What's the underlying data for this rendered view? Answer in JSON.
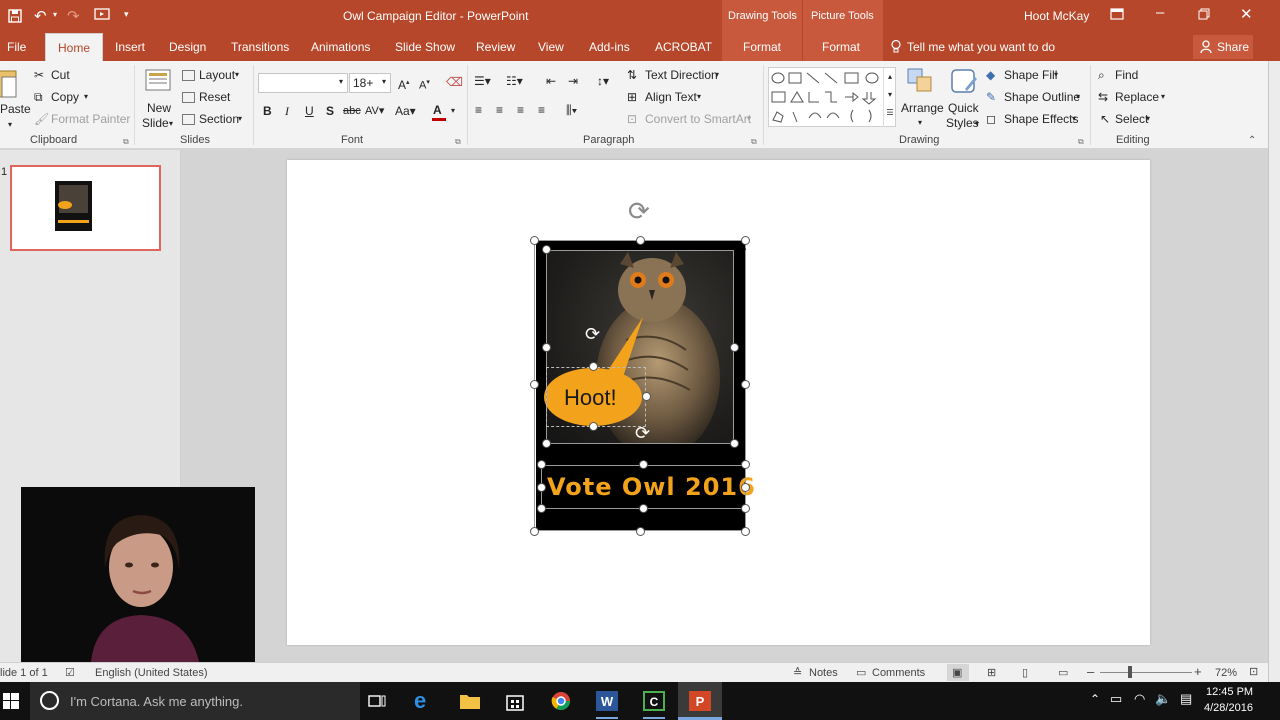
{
  "window": {
    "title": "Owl Campaign Editor - PowerPoint",
    "ctx_drawing": "Drawing Tools",
    "ctx_picture": "Picture Tools",
    "user": "Hoot McKay"
  },
  "tabs": [
    "File",
    "Home",
    "Insert",
    "Design",
    "Transitions",
    "Animations",
    "Slide Show",
    "Review",
    "View",
    "Add-ins",
    "ACROBAT",
    "Format",
    "Format"
  ],
  "tell_me": "Tell me what you want to do",
  "share": "Share",
  "clipboard": {
    "paste": "Paste",
    "cut": "Cut",
    "copy": "Copy",
    "format_painter": "Format Painter",
    "label": "Clipboard"
  },
  "slides_group": {
    "new_slide": "New",
    "new_slide2": "Slide",
    "layout": "Layout",
    "reset": "Reset",
    "section": "Section",
    "label": "Slides"
  },
  "font_group": {
    "font_name": "",
    "font_size": "18+",
    "bold": "B",
    "italic": "I",
    "underline": "U",
    "shadow": "S",
    "strike": "abc",
    "label": "Font"
  },
  "paragraph_group": {
    "text_direction": "Text Direction",
    "align_text": "Align Text",
    "smartart": "Convert to SmartArt",
    "label": "Paragraph"
  },
  "drawing_group": {
    "arrange": "Arrange",
    "quick": "Quick",
    "styles": "Styles",
    "shape_fill": "Shape Fill",
    "shape_outline": "Shape Outline",
    "shape_effects": "Shape Effects",
    "label": "Drawing"
  },
  "editing_group": {
    "find": "Find",
    "replace": "Replace",
    "select": "Select",
    "label": "Editing"
  },
  "thumb": {
    "number": "1"
  },
  "slide": {
    "bubble_text": "Hoot!",
    "vote_text": "Vote Owl 2016"
  },
  "status": {
    "slide_info": "lide 1 of 1",
    "language": "English (United States)",
    "notes": "Notes",
    "comments": "Comments",
    "zoom": "72%"
  },
  "taskbar": {
    "cortana": "I'm Cortana. Ask me anything.",
    "time": "12:45 PM",
    "date": "4/28/2016"
  },
  "colors": {
    "accent": "#b7472a",
    "bubble": "#f2a31b",
    "vote": "#f2a31b"
  }
}
